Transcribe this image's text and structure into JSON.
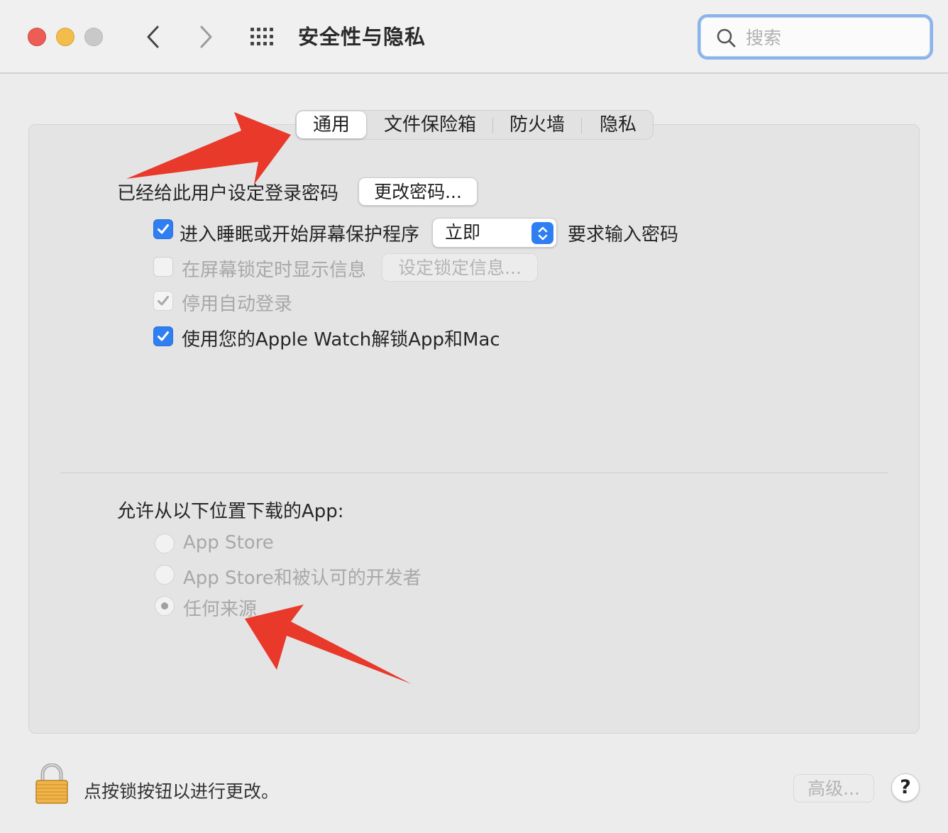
{
  "window": {
    "title": "安全性与隐私",
    "search_placeholder": "搜索"
  },
  "tabs": [
    {
      "label": "通用",
      "active": true
    },
    {
      "label": "文件保险箱",
      "active": false
    },
    {
      "label": "防火墙",
      "active": false
    },
    {
      "label": "隐私",
      "active": false
    }
  ],
  "general": {
    "password_label": "已经给此用户设定登录密码",
    "change_password_button": "更改密码...",
    "sleep_checkbox": {
      "label": "进入睡眠或开始屏幕保护程序",
      "checked": true
    },
    "require_select_value": "立即",
    "require_suffix": "要求输入密码",
    "lock_message_checkbox": {
      "label": "在屏幕锁定时显示信息",
      "checked": false,
      "enabled": false
    },
    "lock_message_button": "设定锁定信息...",
    "disable_autologin_checkbox": {
      "label": "停用自动登录",
      "checked": true,
      "enabled": false
    },
    "apple_watch_checkbox": {
      "label": "使用您的Apple Watch解锁App和Mac",
      "checked": true
    }
  },
  "downloads": {
    "heading": "允许从以下位置下载的App:",
    "options": [
      {
        "label": "App Store",
        "selected": false
      },
      {
        "label": "App Store和被认可的开发者",
        "selected": false
      },
      {
        "label": "任何来源",
        "selected": true
      }
    ]
  },
  "footer": {
    "lock_text": "点按锁按钮以进行更改。",
    "advanced_button": "高级...",
    "help_label": "?"
  },
  "colors": {
    "accent": "#2f7ff3",
    "annotation_arrow": "#e8392b"
  }
}
